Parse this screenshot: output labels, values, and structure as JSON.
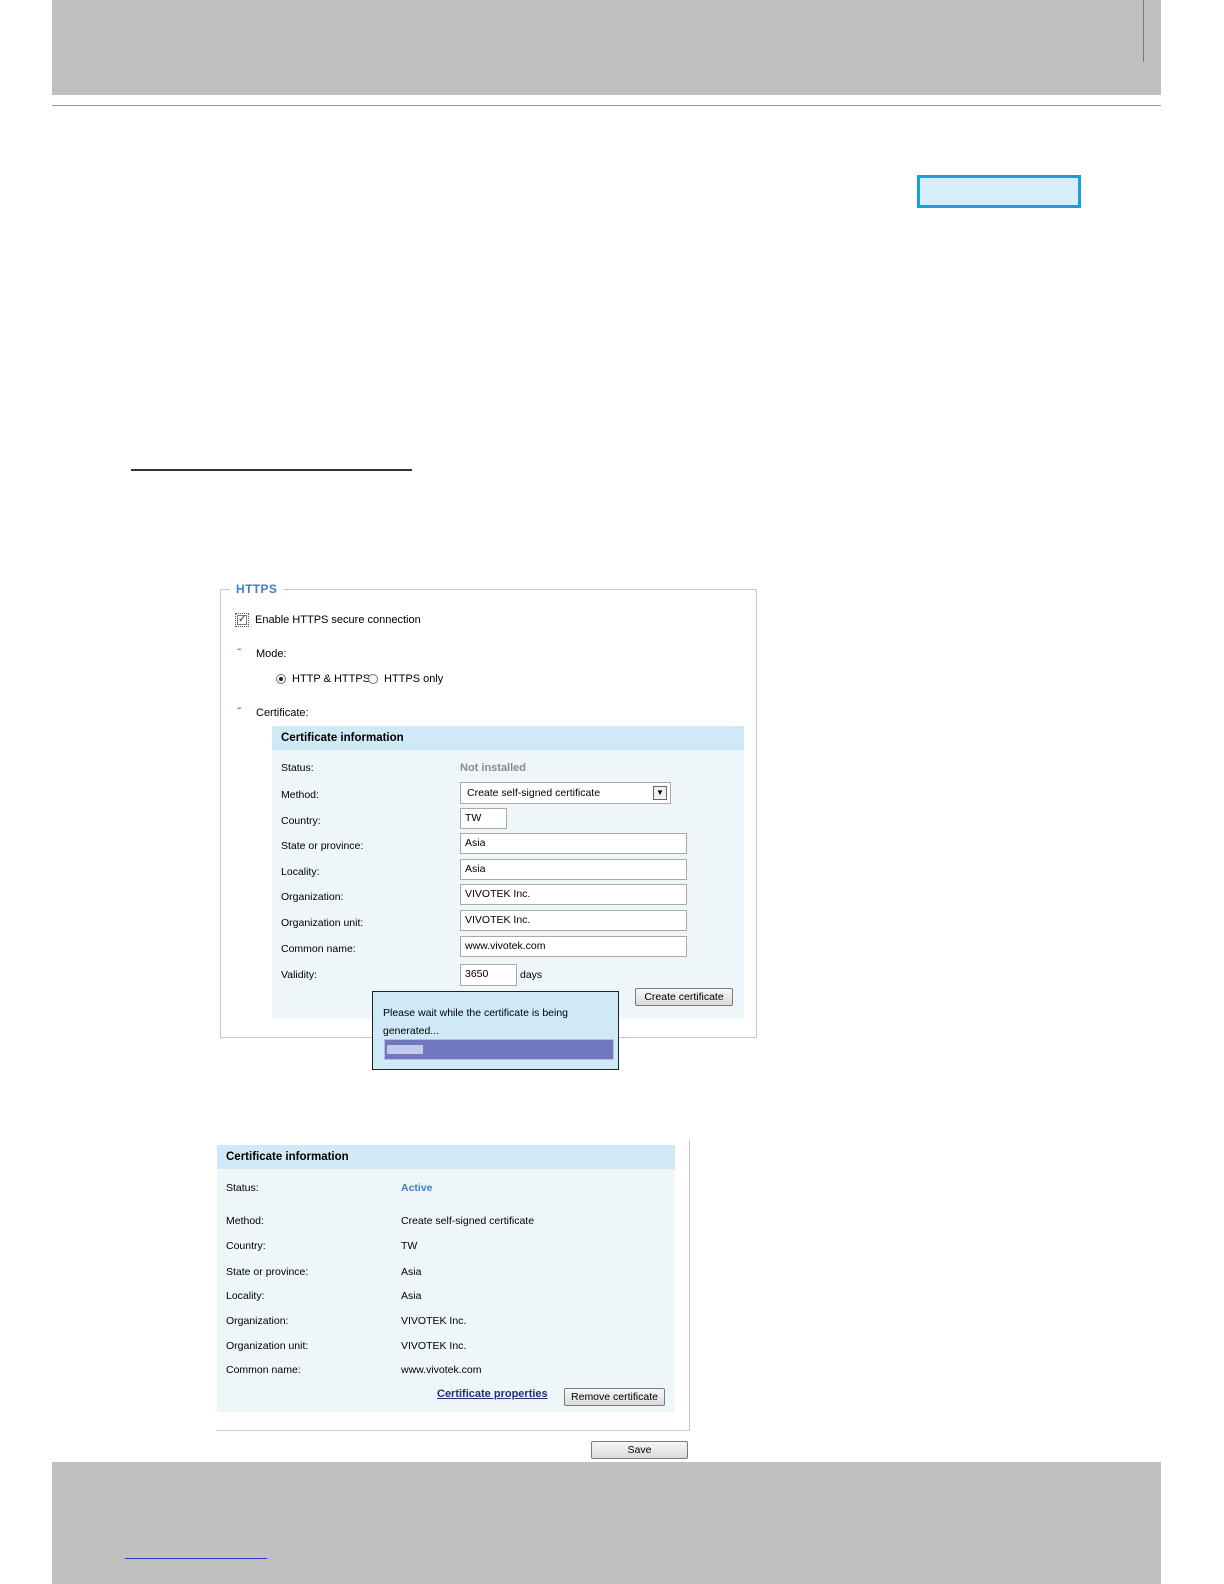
{
  "https": {
    "legend": "HTTPS",
    "enable_label": "Enable HTTPS secure connection",
    "enable_checked": true,
    "mode_label": "Mode:",
    "mode_options": [
      "HTTP & HTTPS",
      "HTTPS only"
    ],
    "mode_selected": "HTTP & HTTPS",
    "certificate_label": "Certificate:"
  },
  "create_form": {
    "header": "Certificate information",
    "status_label": "Status:",
    "status_value": "Not installed",
    "method_label": "Method:",
    "method_value": "Create self-signed certificate",
    "country_label": "Country:",
    "country_value": "TW",
    "state_label": "State or province:",
    "state_value": "Asia",
    "locality_label": "Locality:",
    "locality_value": "Asia",
    "organization_label": "Organization:",
    "organization_value": "VIVOTEK Inc.",
    "org_unit_label": "Organization unit:",
    "org_unit_value": "VIVOTEK Inc.",
    "common_name_label": "Common name:",
    "common_name_value": "www.vivotek.com",
    "validity_label": "Validity:",
    "validity_value": "3650",
    "validity_unit": "days",
    "create_button": "Create certificate"
  },
  "wait_dialog": {
    "message": "Please wait while the certificate is being generated...",
    "progress": 0.16
  },
  "installed": {
    "header": "Certificate information",
    "status_label": "Status:",
    "status_value": "Active",
    "method_label": "Method:",
    "method_value": "Create self-signed certificate",
    "country_label": "Country:",
    "country_value": "TW",
    "state_label": "State or province:",
    "state_value": "Asia",
    "locality_label": "Locality:",
    "locality_value": "Asia",
    "organization_label": "Organization:",
    "organization_value": "VIVOTEK Inc.",
    "org_unit_label": "Organization unit:",
    "org_unit_value": "VIVOTEK Inc.",
    "common_name_label": "Common name:",
    "common_name_value": "www.vivotek.com",
    "properties_link": "Certificate properties",
    "remove_button": "Remove certificate"
  },
  "save_button": "Save",
  "colors": {
    "accent_blue": "#1aa0de",
    "legend_blue": "#3f7fc0",
    "panel_header": "#cfeaf6",
    "panel_body": "#eef6f9",
    "progress_bar": "#7078bf",
    "page_band": "#c0c0c0"
  }
}
